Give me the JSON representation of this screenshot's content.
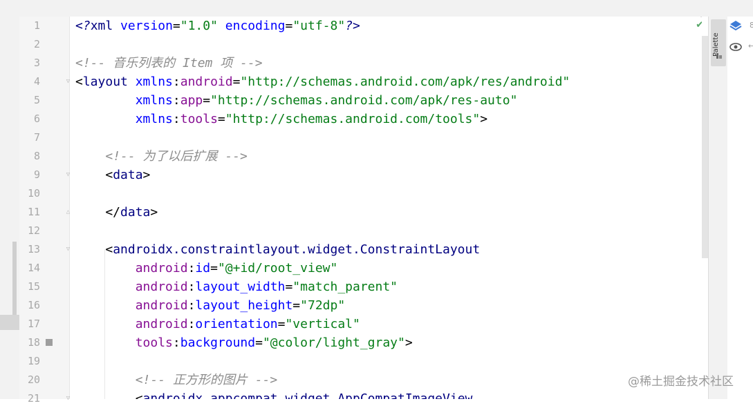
{
  "editor": {
    "line_numbers": [
      "1",
      "2",
      "3",
      "4",
      "5",
      "6",
      "7",
      "8",
      "9",
      "10",
      "11",
      "12",
      "13",
      "14",
      "15",
      "16",
      "17",
      "18",
      "19",
      "20",
      "21"
    ],
    "lines": [
      [
        {
          "t": "pi",
          "v": "<?"
        },
        {
          "t": "tag",
          "v": "xml "
        },
        {
          "t": "attr",
          "v": "version"
        },
        {
          "t": "punct",
          "v": "="
        },
        {
          "t": "val",
          "v": "\"1.0\" "
        },
        {
          "t": "attr",
          "v": "encoding"
        },
        {
          "t": "punct",
          "v": "="
        },
        {
          "t": "val",
          "v": "\"utf-8\""
        },
        {
          "t": "pi",
          "v": "?>"
        }
      ],
      [],
      [
        {
          "t": "cmt",
          "v": "<!-- 音乐列表的 Item 项 -->"
        }
      ],
      [
        {
          "t": "punct",
          "v": "<"
        },
        {
          "t": "tag",
          "v": "layout "
        },
        {
          "t": "attr",
          "v": "xmlns"
        },
        {
          "t": "punct",
          "v": ":"
        },
        {
          "t": "ns",
          "v": "android"
        },
        {
          "t": "punct",
          "v": "="
        },
        {
          "t": "val",
          "v": "\"http://schemas.android.com/apk/res/android\""
        }
      ],
      [
        {
          "t": "punct",
          "v": "        "
        },
        {
          "t": "attr",
          "v": "xmlns"
        },
        {
          "t": "punct",
          "v": ":"
        },
        {
          "t": "ns",
          "v": "app"
        },
        {
          "t": "punct",
          "v": "="
        },
        {
          "t": "val",
          "v": "\"http://schemas.android.com/apk/res-auto\""
        }
      ],
      [
        {
          "t": "punct",
          "v": "        "
        },
        {
          "t": "attr",
          "v": "xmlns"
        },
        {
          "t": "punct",
          "v": ":"
        },
        {
          "t": "ns",
          "v": "tools"
        },
        {
          "t": "punct",
          "v": "="
        },
        {
          "t": "val",
          "v": "\"http://schemas.android.com/tools\""
        },
        {
          "t": "punct",
          "v": ">"
        }
      ],
      [],
      [
        {
          "t": "punct",
          "v": "    "
        },
        {
          "t": "cmt",
          "v": "<!-- 为了以后扩展 -->"
        }
      ],
      [
        {
          "t": "punct",
          "v": "    <"
        },
        {
          "t": "tag",
          "v": "data"
        },
        {
          "t": "punct",
          "v": ">"
        }
      ],
      [],
      [
        {
          "t": "punct",
          "v": "    </"
        },
        {
          "t": "tag",
          "v": "data"
        },
        {
          "t": "punct",
          "v": ">"
        }
      ],
      [],
      [
        {
          "t": "punct",
          "v": "    <"
        },
        {
          "t": "tag",
          "v": "androidx.constraintlayout.widget.ConstraintLayout"
        }
      ],
      [
        {
          "t": "punct",
          "v": "        "
        },
        {
          "t": "ns",
          "v": "android"
        },
        {
          "t": "punct",
          "v": ":"
        },
        {
          "t": "attr",
          "v": "id"
        },
        {
          "t": "punct",
          "v": "="
        },
        {
          "t": "val",
          "v": "\"@+id/root_view\""
        }
      ],
      [
        {
          "t": "punct",
          "v": "        "
        },
        {
          "t": "ns",
          "v": "android"
        },
        {
          "t": "punct",
          "v": ":"
        },
        {
          "t": "attr",
          "v": "layout_width"
        },
        {
          "t": "punct",
          "v": "="
        },
        {
          "t": "val",
          "v": "\"match_parent\""
        }
      ],
      [
        {
          "t": "punct",
          "v": "        "
        },
        {
          "t": "ns",
          "v": "android"
        },
        {
          "t": "punct",
          "v": ":"
        },
        {
          "t": "attr",
          "v": "layout_height"
        },
        {
          "t": "punct",
          "v": "="
        },
        {
          "t": "val",
          "v": "\"72dp\""
        }
      ],
      [
        {
          "t": "punct",
          "v": "        "
        },
        {
          "t": "ns",
          "v": "android"
        },
        {
          "t": "punct",
          "v": ":"
        },
        {
          "t": "attr",
          "v": "orientation"
        },
        {
          "t": "punct",
          "v": "="
        },
        {
          "t": "val",
          "v": "\"vertical\""
        }
      ],
      [
        {
          "t": "punct",
          "v": "        "
        },
        {
          "t": "ns",
          "v": "tools"
        },
        {
          "t": "punct",
          "v": ":"
        },
        {
          "t": "attr",
          "v": "background"
        },
        {
          "t": "punct",
          "v": "="
        },
        {
          "t": "val",
          "v": "\"@color/light_gray\""
        },
        {
          "t": "punct",
          "v": ">"
        }
      ],
      [],
      [
        {
          "t": "punct",
          "v": "        "
        },
        {
          "t": "cmt",
          "v": "<!-- 正方形的图片 -->"
        }
      ],
      [
        {
          "t": "punct",
          "v": "        <"
        },
        {
          "t": "tag",
          "v": "androidx.appcompat.widget.AppCompatImageView"
        }
      ]
    ],
    "fold_markers": [
      4,
      9,
      11,
      13,
      21
    ],
    "bookmark_line": 18
  },
  "side_panel": {
    "tab_label": "Palette"
  },
  "watermark": "@稀土掘金技术社区",
  "colors": {
    "tag": "#000080",
    "attr": "#0000ff",
    "namespace": "#871094",
    "value": "#067d17",
    "comment": "#8c8c8c",
    "check": "#59a869"
  }
}
